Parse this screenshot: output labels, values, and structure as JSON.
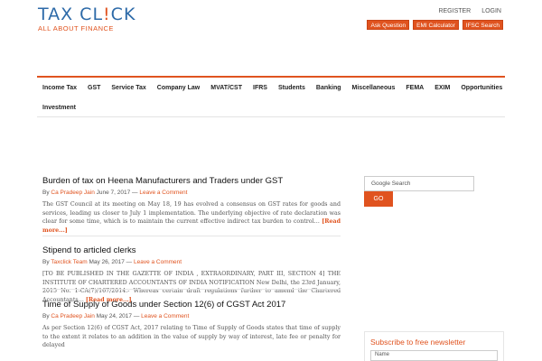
{
  "header": {
    "logo_text_1": "TAX CL",
    "logo_text_tick": "!",
    "logo_text_2": "CK",
    "logo_tagline": "ALL ABOUT FINANCE",
    "register": "REGISTER",
    "login": "LOGIN",
    "buttons": [
      "Ask Question",
      "EMI Calculator",
      "IFSC Search"
    ]
  },
  "nav": {
    "row1": [
      "Income Tax",
      "GST",
      "Service Tax",
      "Company Law",
      "MVAT/CST",
      "IFRS",
      "Students",
      "Banking",
      "Miscellaneous",
      "FEMA",
      "EXIM",
      "Opportunities"
    ],
    "row2": [
      "Investment"
    ]
  },
  "posts": [
    {
      "title": "Burden of tax on Heena Manufacturers and Traders under GST",
      "by": "By",
      "author": "Ca Pradeep Jain",
      "date": "June 7, 2017",
      "sep": "—",
      "comment": "Leave a Comment",
      "excerpt": "The GST Council at its meeting on May 18, 19 has evolved a consensus on GST rates for goods and services, leading us closer to July 1 implementation. The underlying objective of rate declaration was clear for some time, which is to maintain the current effective indirect tax burden to control…",
      "readmore": "[Read more...]"
    },
    {
      "title": "Stipend to articled clerks",
      "by": "By",
      "author": "Taxclick Team",
      "date": "May 26, 2017",
      "sep": "—",
      "comment": "Leave a Comment",
      "excerpt": "[TO BE PUBLISHED IN THE GAZETTE OF INDIA , EXTRAORDINARY, PART III, SECTION 4] THE INSTITUTE OF CHARTERED ACCOUNTANTS OF INDIA NOTIFICATION  New Delhi, the 23rd January, 2015    No. 1-CA(7)/167/2014.- Whereas certain draft regulations further to amend the Chartered Accountants…",
      "readmore": "[Read more...]"
    },
    {
      "title": "Time of Supply of Goods under Section 12(6) of CGST Act 2017",
      "by": "By",
      "author": "Ca Pradeep Jain",
      "date": "May 24, 2017",
      "sep": "—",
      "comment": "Leave a Comment",
      "excerpt": "As per Section 12(6) of CGST Act, 2017 relating to Time of Supply of Goods states that time of supply to the extent it relates to an addition in the value of supply by way of interest, late fee or penalty for delayed",
      "readmore": ""
    }
  ],
  "sidebar": {
    "search_placeholder": "Google Search",
    "go": "GO",
    "newsletter_title": "Subscribe to free newsletter",
    "newsletter_field": "Name"
  }
}
